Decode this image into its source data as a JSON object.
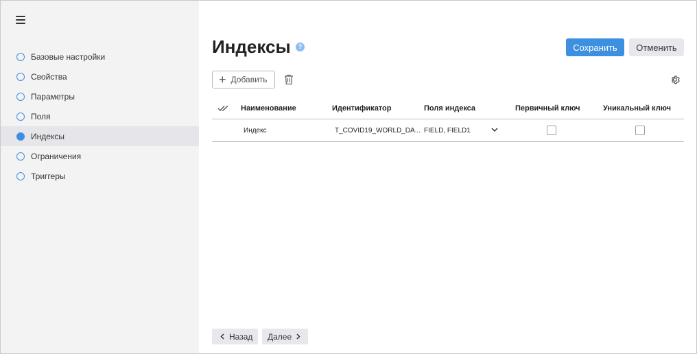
{
  "sidebar": {
    "items": [
      {
        "label": "Базовые настройки",
        "active": false
      },
      {
        "label": "Свойства",
        "active": false
      },
      {
        "label": "Параметры",
        "active": false
      },
      {
        "label": "Поля",
        "active": false
      },
      {
        "label": "Индексы",
        "active": true
      },
      {
        "label": "Ограничения",
        "active": false
      },
      {
        "label": "Триггеры",
        "active": false
      }
    ]
  },
  "header": {
    "title": "Индексы",
    "help_glyph": "?",
    "save_label": "Сохранить",
    "cancel_label": "Отменить"
  },
  "toolbar": {
    "add_label": "Добавить"
  },
  "table": {
    "columns": [
      "Наименование",
      "Идентификатор",
      "Поля индекса",
      "Первичный ключ",
      "Уникальный ключ"
    ],
    "rows": [
      {
        "name": "Индекс",
        "identifier": "T_COVID19_WORLD_DA...",
        "fields": "FIELD, FIELD1",
        "primary_key": false,
        "unique_key": false
      }
    ]
  },
  "footer": {
    "back_label": "Назад",
    "next_label": "Далее"
  },
  "colors": {
    "accent": "#3d8fe0",
    "sidebar_bg": "#f3f3f3",
    "active_item_bg": "#e6e6ea",
    "secondary_button_bg": "#e8e8ec"
  },
  "icons": {
    "menu": "hamburger-menu-icon",
    "help": "question-mark-icon",
    "add": "plus-icon",
    "delete": "trash-icon",
    "settings": "gear-icon",
    "select_all": "double-check-icon",
    "expand": "chevron-down-icon",
    "back": "chevron-left-icon",
    "next": "chevron-right-icon"
  }
}
